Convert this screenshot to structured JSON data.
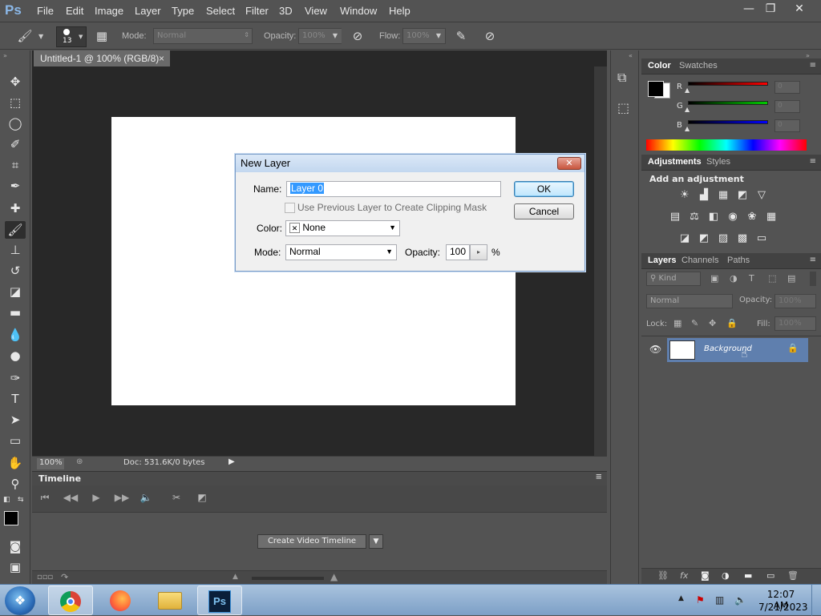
{
  "app": {
    "logo": "Ps"
  },
  "menu": [
    "File",
    "Edit",
    "Image",
    "Layer",
    "Type",
    "Select",
    "Filter",
    "3D",
    "View",
    "Window",
    "Help"
  ],
  "window_controls": {
    "minimize": "—",
    "restore": "❐",
    "close": "✕"
  },
  "options": {
    "brush_size": "13",
    "mode_label": "Mode:",
    "mode_value": "Normal",
    "opacity_label": "Opacity:",
    "opacity_value": "100%",
    "flow_label": "Flow:",
    "flow_value": "100%"
  },
  "document": {
    "tab_title": "Untitled-1 @ 100% (RGB/8)",
    "tab_close": "×",
    "zoom": "100%",
    "doc_info": "Doc: 531.6K/0 bytes"
  },
  "timeline": {
    "title": "Timeline",
    "create_button": "Create Video Timeline"
  },
  "color_panel": {
    "tabs": [
      "Color",
      "Swatches"
    ],
    "channels": [
      {
        "label": "R",
        "value": "0",
        "color": "#e02020"
      },
      {
        "label": "G",
        "value": "0",
        "color": "#20c020"
      },
      {
        "label": "B",
        "value": "0",
        "color": "#2020e0"
      }
    ]
  },
  "adjustments_panel": {
    "tabs": [
      "Adjustments",
      "Styles"
    ],
    "subtitle": "Add an adjustment"
  },
  "layers_panel": {
    "tabs": [
      "Layers",
      "Channels",
      "Paths"
    ],
    "kind_label": "Kind",
    "blend_mode": "Normal",
    "opacity_label": "Opacity:",
    "opacity_value": "100%",
    "lock_label": "Lock:",
    "fill_label": "Fill:",
    "fill_value": "100%",
    "layers": [
      {
        "name": "Background"
      }
    ]
  },
  "dialog": {
    "title": "New Layer",
    "close": "✕",
    "name_label": "Name:",
    "name_value": "Layer 0",
    "clipping_label": "Use Previous Layer to Create Clipping Mask",
    "color_label": "Color:",
    "color_value": "None",
    "mode_label": "Mode:",
    "mode_value": "Normal",
    "opacity_label": "Opacity:",
    "opacity_value": "100",
    "opacity_unit": "%",
    "ok_label": "OK",
    "cancel_label": "Cancel"
  },
  "taskbar": {
    "time": "12:07 AM",
    "date": "7/21/2023"
  }
}
